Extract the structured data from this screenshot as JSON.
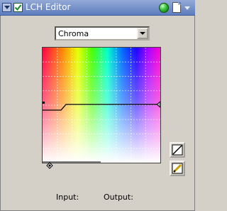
{
  "window": {
    "title": "LCH Editor",
    "enabled": true
  },
  "mode_select": {
    "selected": "Chroma"
  },
  "readout": {
    "input_label": "Input:",
    "output_label": "Output:"
  },
  "colors": {
    "titlebar": "#5d7dbf",
    "panel": "#d4d0c8",
    "status_led": "#38c238"
  },
  "icons": {
    "collapse": "triangle-down",
    "enable": "check",
    "status": "green-dot",
    "page": "document",
    "menu": "triangle-down",
    "curve_reset": "diagonal-line",
    "curve_draw": "pencil"
  }
}
